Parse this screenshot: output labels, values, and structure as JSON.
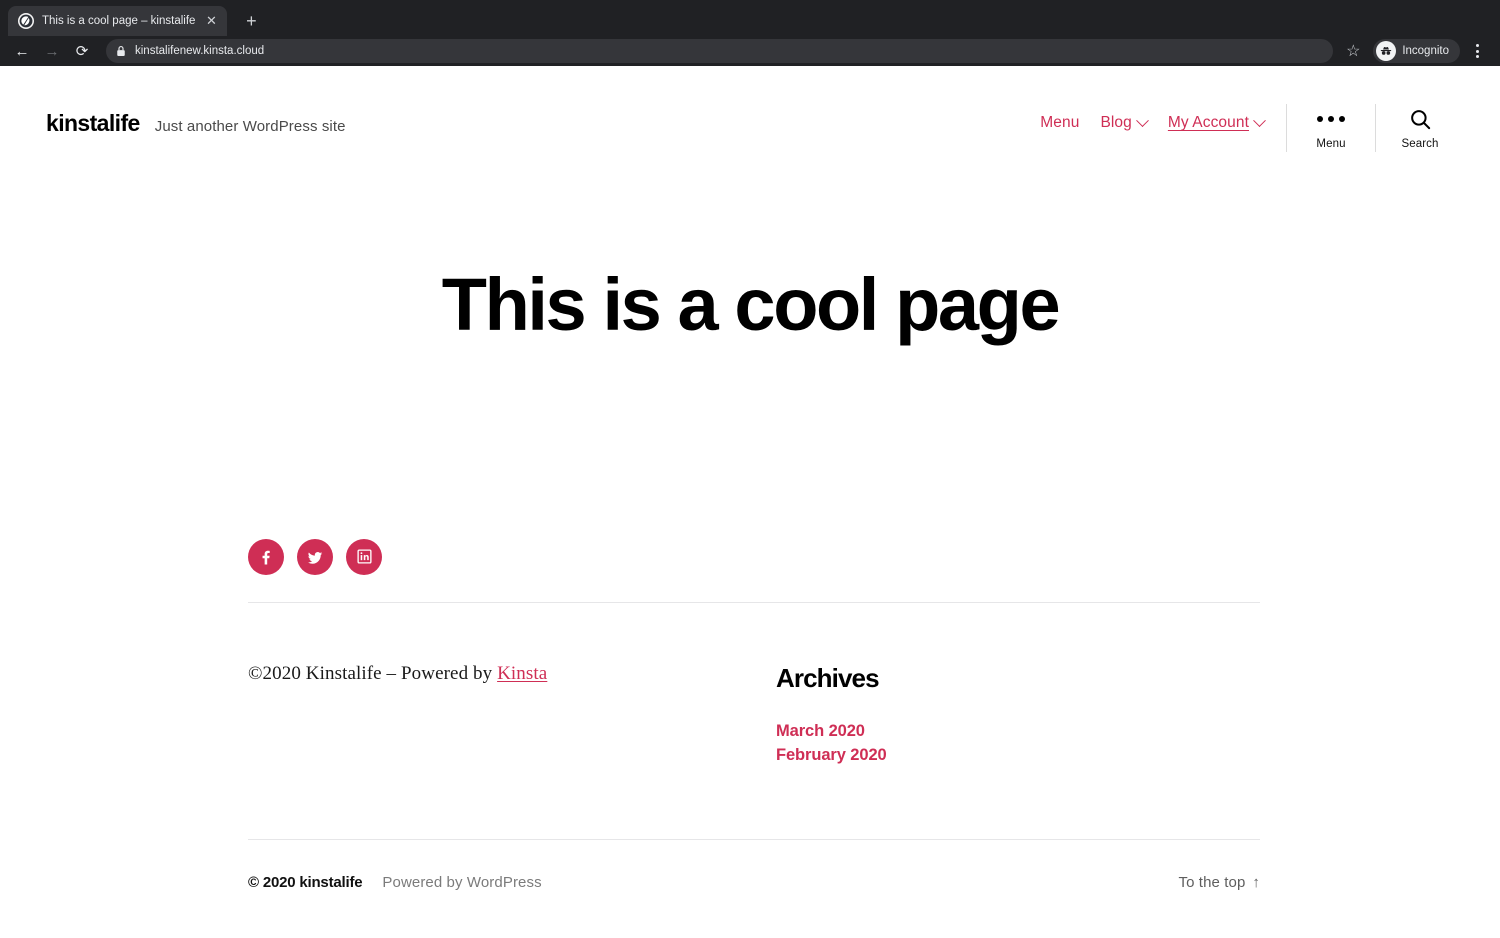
{
  "browser": {
    "tab": {
      "title": "This is a cool page – kinstalife",
      "favicon_name": "wordpress-globe-icon",
      "close_label": "✕"
    },
    "new_tab_label": "+",
    "back_label": "←",
    "forward_label": "→",
    "reload_label": "⟳",
    "url": "kinstalifenew.kinsta.cloud",
    "lock_icon": "lock-icon",
    "star_label": "☆",
    "profile_label": "Incognito",
    "menu_label": "⋮"
  },
  "colors": {
    "accent": "#cf2e55",
    "text": "#000000",
    "muted": "#7b7b7b",
    "chrome_bg": "#202124",
    "chrome_field": "#35363a",
    "divider": "#e6e6e8"
  },
  "header": {
    "site_title": "kinstalife",
    "tagline": "Just another WordPress site",
    "nav": [
      {
        "label": "Menu",
        "has_chevron": false,
        "current": false
      },
      {
        "label": "Blog",
        "has_chevron": true,
        "current": false
      },
      {
        "label": "My Account",
        "has_chevron": true,
        "current": true
      }
    ],
    "utilities": [
      {
        "label": "Menu",
        "icon": "dots-icon"
      },
      {
        "label": "Search",
        "icon": "search-icon"
      }
    ]
  },
  "hero": {
    "title": "This is a cool page"
  },
  "social": [
    {
      "name": "facebook-icon",
      "label": "Facebook"
    },
    {
      "name": "twitter-icon",
      "label": "Twitter"
    },
    {
      "name": "linkedin-icon",
      "label": "LinkedIn"
    }
  ],
  "footer_credit": {
    "prefix": "©2020 Kinstalife – Powered by ",
    "link_label": "Kinsta"
  },
  "widget": {
    "title": "Archives",
    "links": [
      {
        "label": "March 2020"
      },
      {
        "label": "February 2020"
      }
    ]
  },
  "site_footer": {
    "brand": "© 2020 kinstalife",
    "powered": "Powered by WordPress",
    "to_top": "To the top",
    "to_top_arrow": "↑"
  }
}
